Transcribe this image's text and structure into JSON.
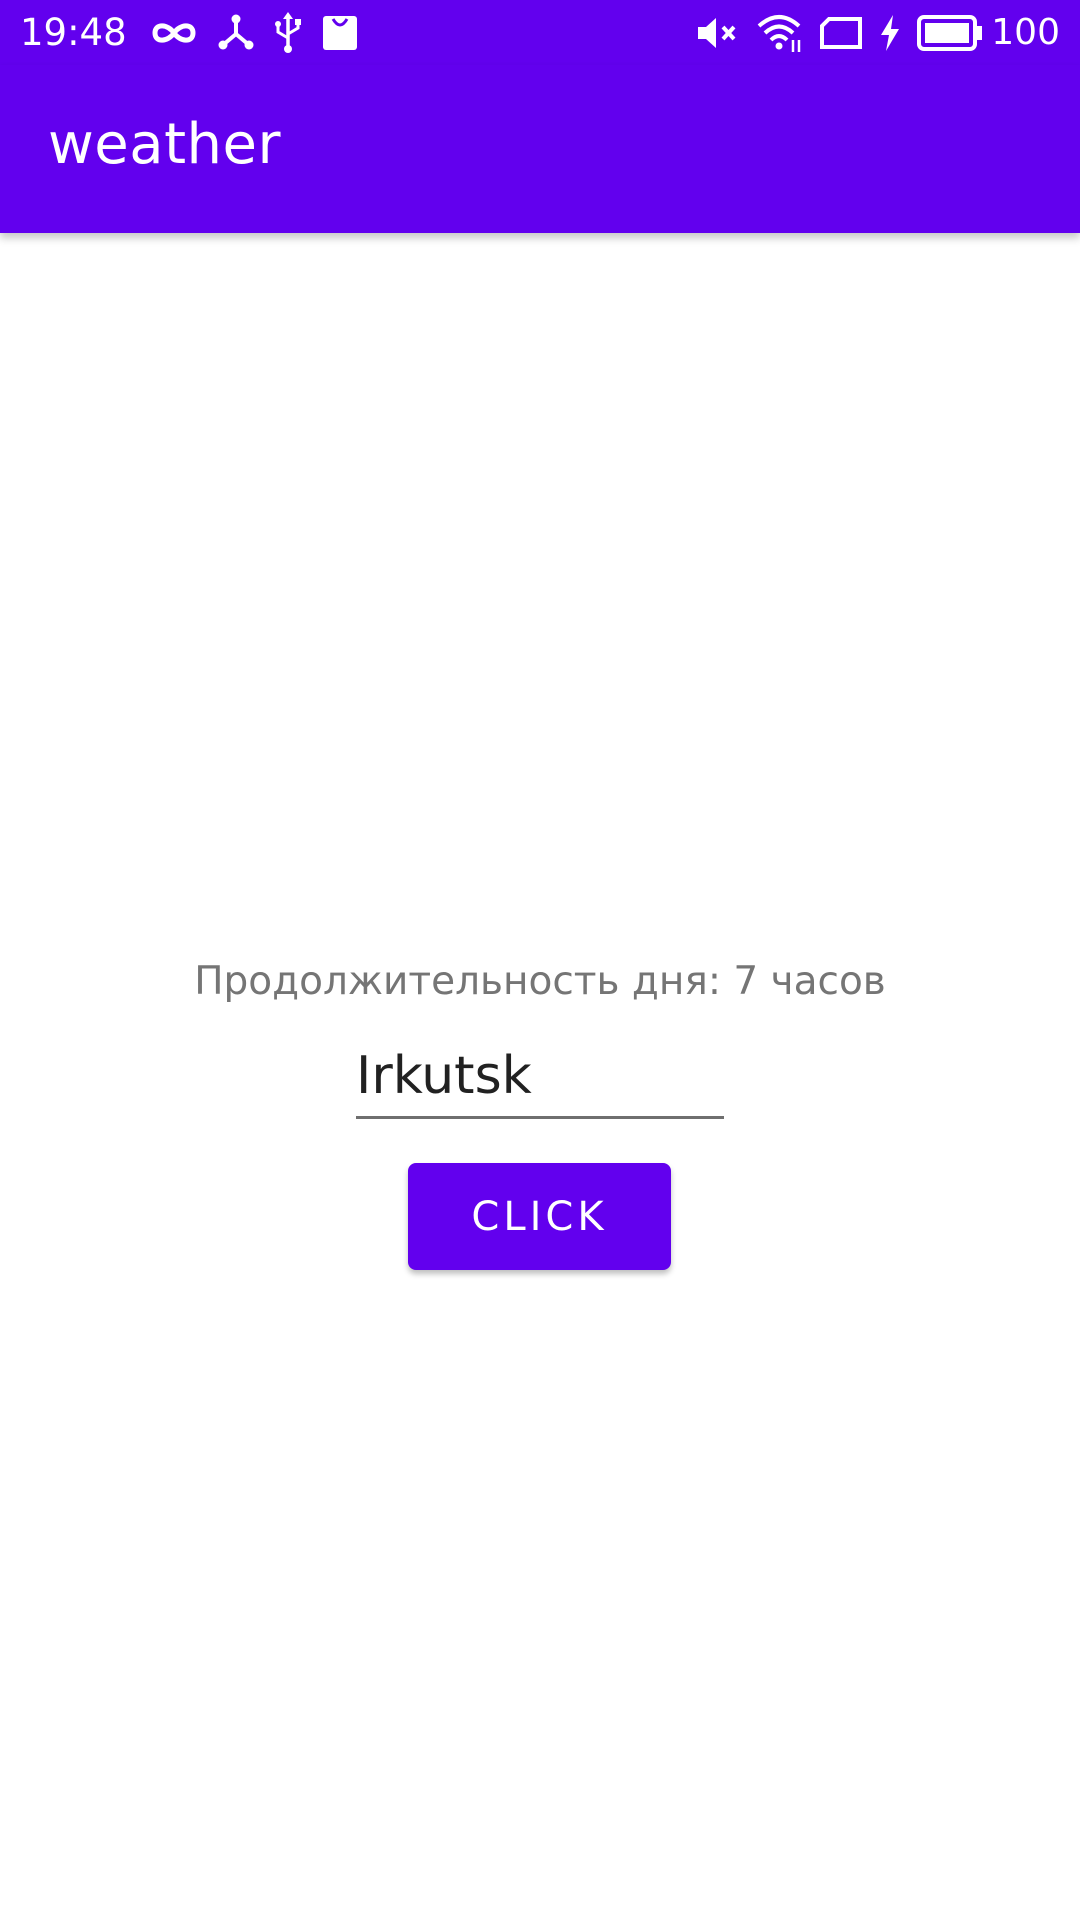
{
  "status_bar": {
    "time": "19:48",
    "battery_percent": "100",
    "left_icons": [
      "infinity-icon",
      "hub-icon",
      "usb-icon",
      "shopping-bag-icon"
    ],
    "right_icons": [
      "volume-muted-icon",
      "wifi-icon",
      "sim-card-icon",
      "charging-icon",
      "battery-icon"
    ]
  },
  "app_bar": {
    "title": "weather"
  },
  "main": {
    "day_length_text": "Продолжительность дня: 7 часов",
    "city_input_value": "Irkutsk",
    "button_label": "CLICK"
  },
  "colors": {
    "primary": "#6200ee",
    "secondary_text": "#757575",
    "primary_text": "#212121"
  }
}
